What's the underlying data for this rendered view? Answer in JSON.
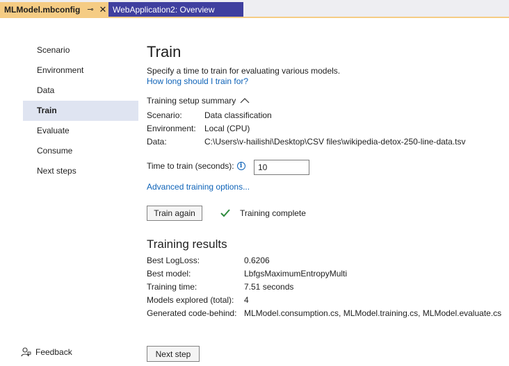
{
  "tabs": {
    "active": {
      "label": "MLModel.mbconfig",
      "pin_glyph": "⊸",
      "close_glyph": "✕"
    },
    "inactive": {
      "label": "WebApplication2: Overview"
    }
  },
  "sidebar": {
    "items": [
      {
        "label": "Scenario"
      },
      {
        "label": "Environment"
      },
      {
        "label": "Data"
      },
      {
        "label": "Train"
      },
      {
        "label": "Evaluate"
      },
      {
        "label": "Consume"
      },
      {
        "label": "Next steps"
      }
    ],
    "active_index": 3,
    "feedback_label": "Feedback"
  },
  "main": {
    "title": "Train",
    "subtitle": "Specify a time to train for evaluating various models.",
    "help_link": "How long should I train for?",
    "summary": {
      "heading": "Training setup summary",
      "rows": [
        {
          "key": "Scenario:",
          "value": "Data classification"
        },
        {
          "key": "Environment:",
          "value": "Local (CPU)"
        },
        {
          "key": "Data:",
          "value": "C:\\Users\\v-hailishi\\Desktop\\CSV files\\wikipedia-detox-250-line-data.tsv"
        }
      ]
    },
    "time_to_train": {
      "label": "Time to train (seconds):",
      "value": "10",
      "info_glyph": "i"
    },
    "advanced_link": "Advanced training options...",
    "train_again_label": "Train again",
    "status_text": "Training complete",
    "results": {
      "heading": "Training results",
      "rows": [
        {
          "key": "Best LogLoss:",
          "value": "0.6206"
        },
        {
          "key": "Best model:",
          "value": "LbfgsMaximumEntropyMulti"
        },
        {
          "key": "Training time:",
          "value": "7.51 seconds"
        },
        {
          "key": "Models explored (total):",
          "value": "4"
        },
        {
          "key": "Generated code-behind:",
          "value": "MLModel.consumption.cs, MLModel.training.cs, MLModel.evaluate.cs"
        }
      ]
    },
    "next_step_label": "Next step"
  },
  "colors": {
    "tab_active_bg": "#f5cc84",
    "tab_inactive_bg": "#3f3f9f",
    "sidebar_active_bg": "#dfe4f1",
    "link": "#0e63b8",
    "success_check": "#2e8b3d"
  }
}
